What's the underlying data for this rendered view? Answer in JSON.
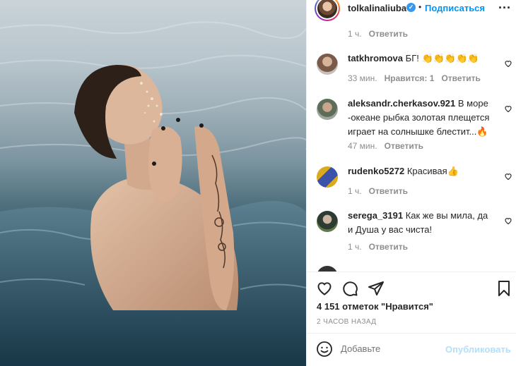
{
  "post": {
    "username": "tolkalinaliuba",
    "separator": "•",
    "follow_label": "Подписаться",
    "more_label": "···"
  },
  "top_comment_meta": {
    "time": "1 ч.",
    "reply": "Ответить"
  },
  "comments": [
    {
      "username": "tatkhromova",
      "text": "БГ! 👏👏👏👏👏",
      "time": "33 мин.",
      "likes": "Нравится: 1",
      "reply": "Ответить"
    },
    {
      "username": "aleksandr.cherkasov.921",
      "text": "В море -океане рыбка золотая плещется играет на солнышке блестит...🔥",
      "time": "47 мин.",
      "reply": "Ответить"
    },
    {
      "username": "rudenko5272",
      "text": "Красивая👍",
      "time": "1 ч.",
      "reply": "Ответить"
    },
    {
      "username": "serega_3191",
      "text": "Как же вы мила, да и Душа у вас чиста!",
      "time": "1 ч.",
      "reply": "Ответить"
    }
  ],
  "likes_text": "4 151 отметок \"Нравится\"",
  "timestamp": "2 ЧАСОВ НАЗАД",
  "composer": {
    "placeholder": "Добавьте",
    "publish": "Опубликовать"
  },
  "icons": {
    "like": "heart-outline-icon",
    "comment": "speech-bubble-icon",
    "share": "paper-plane-icon",
    "save": "bookmark-icon",
    "emoji": "smiley-icon",
    "verified": "verified-badge-icon",
    "comment_like": "small-heart-icon"
  },
  "colors": {
    "accent": "#0095f6",
    "muted": "#8e8e8e",
    "publish_disabled": "#b2dffc",
    "verified": "#3897f0"
  }
}
